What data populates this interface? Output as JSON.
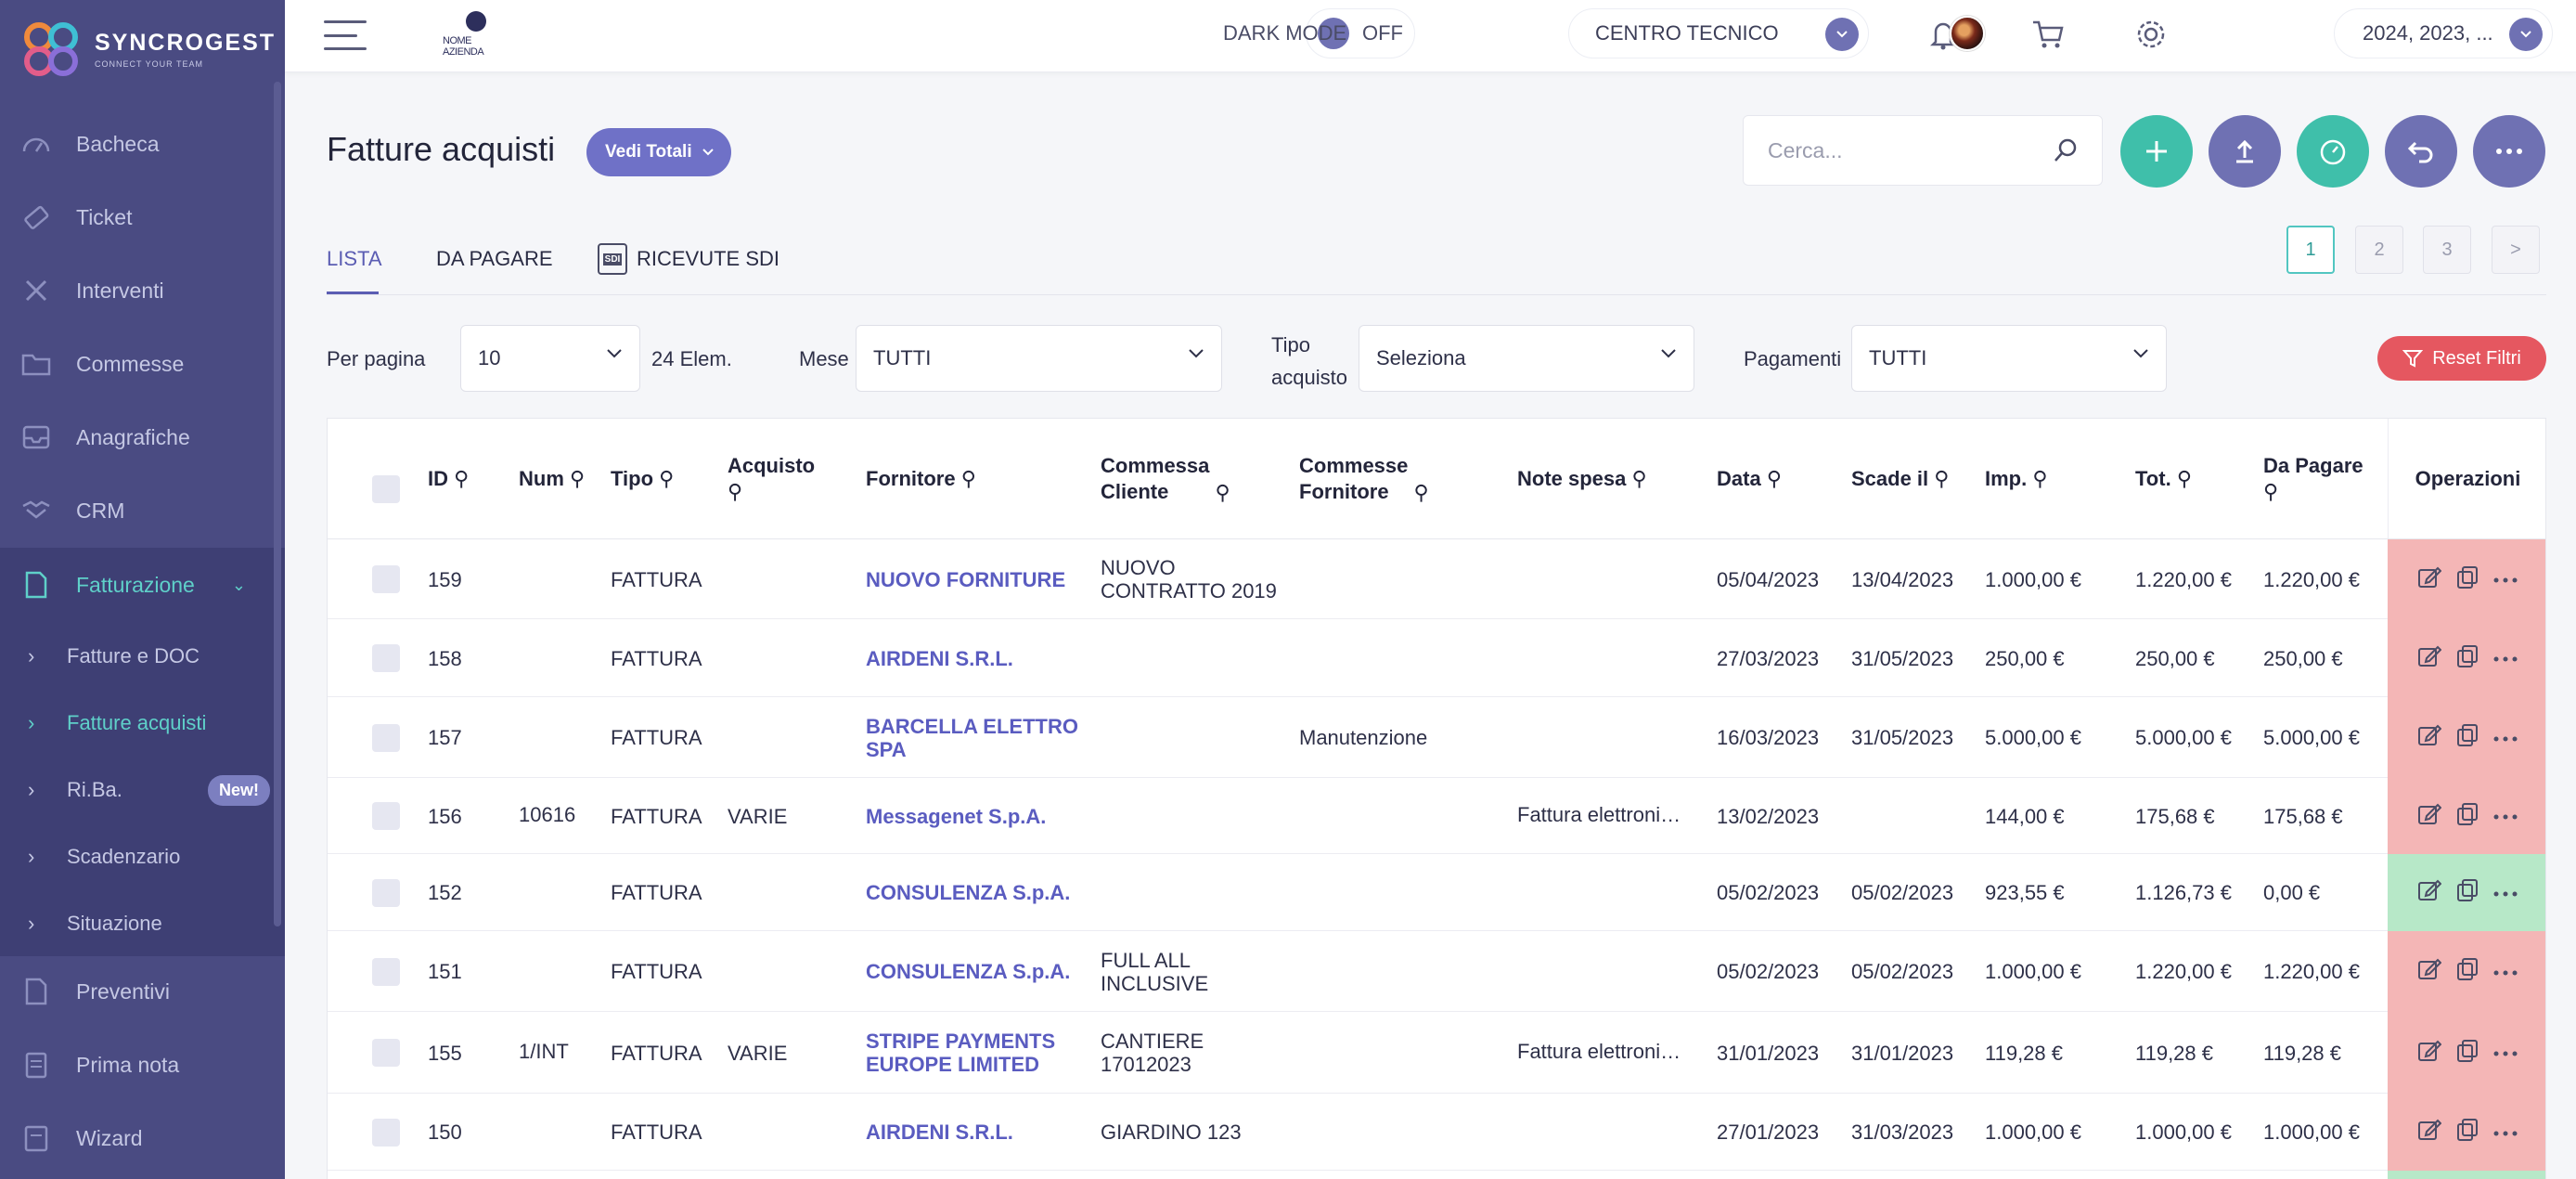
{
  "brand": {
    "name": "SYNCROGEST",
    "tagline": "CONNECT YOUR TEAM"
  },
  "sidebar": {
    "items": [
      {
        "label": "Bacheca",
        "icon": "speedometer-icon"
      },
      {
        "label": "Ticket",
        "icon": "ticket-icon"
      },
      {
        "label": "Interventi",
        "icon": "tools-icon"
      },
      {
        "label": "Commesse",
        "icon": "folder-icon"
      },
      {
        "label": "Anagrafiche",
        "icon": "inbox-icon"
      },
      {
        "label": "CRM",
        "icon": "handshake-icon"
      },
      {
        "label": "Fatturazione",
        "icon": "document-icon"
      }
    ],
    "sub_items": [
      {
        "label": "Fatture e DOC"
      },
      {
        "label": "Fatture acquisti"
      },
      {
        "label": "Ri.Ba.",
        "badge": "New!"
      },
      {
        "label": "Scadenzario"
      },
      {
        "label": "Situazione"
      }
    ],
    "bottom_items": [
      {
        "label": "Preventivi",
        "icon": "quote-doc-icon"
      },
      {
        "label": "Prima nota",
        "icon": "notepad-icon"
      },
      {
        "label": "Wizard",
        "icon": "wizard-icon"
      }
    ]
  },
  "topbar": {
    "company_logo_text": "NOME AZIENDA",
    "dark_mode_label": "DARK MODE",
    "dark_mode_state": "OFF",
    "centro_label": "CENTRO TECNICO",
    "years_label": "2024, 2023, ..."
  },
  "page": {
    "title": "Fatture acquisti",
    "totali_button": "Vedi Totali",
    "search_placeholder": "Cerca...",
    "tabs": [
      "LISTA",
      "DA PAGARE",
      "RICEVUTE SDI"
    ],
    "sdi_icon_text": "SDI",
    "pager": [
      "1",
      "2",
      "3",
      ">"
    ]
  },
  "filters": {
    "per_pagina_label": "Per pagina",
    "per_pagina_value": "10",
    "count_label": "24 Elem.",
    "mese_label": "Mese",
    "mese_value": "TUTTI",
    "tipo_label": "Tipo\nacquisto",
    "tipo_value": "Seleziona",
    "pagamenti_label": "Pagamenti",
    "pagamenti_value": "TUTTI",
    "reset_label": "Reset Filtri"
  },
  "colors": {
    "sidebar": "#4a4b82",
    "accent": "#6f71c7",
    "teal": "#3fbfaa",
    "reset": "#e55760",
    "row_unpaid": "#f4b6b6",
    "row_paid": "#b7e8c8"
  },
  "table": {
    "headers": {
      "id": "ID",
      "num": "Num",
      "tipo": "Tipo",
      "acquisto": "Acquisto",
      "fornitore": "Fornitore",
      "commessa_cliente": "Commessa\nCliente",
      "commesse_fornitore": "Commesse\nFornitore",
      "note_spesa": "Note spesa",
      "data": "Data",
      "scade_il": "Scade il",
      "imp": "Imp.",
      "tot": "Tot.",
      "da_pagare": "Da Pagare",
      "operazioni": "Operazioni"
    },
    "rows": [
      {
        "id": "159",
        "num": "",
        "tipo": "FATTURA",
        "acquisto": "",
        "fornitore": "NUOVO FORNITURE",
        "commessa_cliente": "NUOVO\nCONTRATTO 2019",
        "commesse_fornitore": "",
        "note_spesa": "",
        "data": "05/04/2023",
        "scade_il": "13/04/2023",
        "imp": "1.000,00 €",
        "tot": "1.220,00 €",
        "da_pagare": "1.220,00 €",
        "status": "unpaid"
      },
      {
        "id": "158",
        "num": "",
        "tipo": "FATTURA",
        "acquisto": "",
        "fornitore": "AIRDENI S.R.L.",
        "commessa_cliente": "",
        "commesse_fornitore": "",
        "note_spesa": "",
        "data": "27/03/2023",
        "scade_il": "31/05/2023",
        "imp": "250,00 €",
        "tot": "250,00 €",
        "da_pagare": "250,00 €",
        "status": "unpaid"
      },
      {
        "id": "157",
        "num": "",
        "tipo": "FATTURA",
        "acquisto": "",
        "fornitore": "BARCELLA ELETTRO\nSPA",
        "commessa_cliente": "",
        "commesse_fornitore": "Manutenzione",
        "note_spesa": "",
        "data": "16/03/2023",
        "scade_il": "31/05/2023",
        "imp": "5.000,00 €",
        "tot": "5.000,00 €",
        "da_pagare": "5.000,00 €",
        "status": "unpaid"
      },
      {
        "id": "156",
        "num": "10616",
        "tipo": "FATTURA",
        "acquisto": "VARIE",
        "fornitore": "Messagenet S.p.A.",
        "commessa_cliente": "",
        "commesse_fornitore": "",
        "note_spesa": "Fattura elettroni…",
        "data": "13/02/2023",
        "scade_il": "",
        "imp": "144,00 €",
        "tot": "175,68 €",
        "da_pagare": "175,68 €",
        "status": "unpaid"
      },
      {
        "id": "152",
        "num": "",
        "tipo": "FATTURA",
        "acquisto": "",
        "fornitore": "CONSULENZA S.p.A.",
        "commessa_cliente": "",
        "commesse_fornitore": "",
        "note_spesa": "",
        "data": "05/02/2023",
        "scade_il": "05/02/2023",
        "imp": "923,55 €",
        "tot": "1.126,73 €",
        "da_pagare": "0,00 €",
        "status": "paid"
      },
      {
        "id": "151",
        "num": "",
        "tipo": "FATTURA",
        "acquisto": "",
        "fornitore": "CONSULENZA S.p.A.",
        "commessa_cliente": "FULL ALL\nINCLUSIVE",
        "commesse_fornitore": "",
        "note_spesa": "",
        "data": "05/02/2023",
        "scade_il": "05/02/2023",
        "imp": "1.000,00 €",
        "tot": "1.220,00 €",
        "da_pagare": "1.220,00 €",
        "status": "unpaid"
      },
      {
        "id": "155",
        "num": "1/INT",
        "tipo": "FATTURA",
        "acquisto": "VARIE",
        "fornitore": "STRIPE PAYMENTS\nEUROPE LIMITED",
        "commessa_cliente": "CANTIERE\n17012023",
        "commesse_fornitore": "",
        "note_spesa": "Fattura elettroni…",
        "data": "31/01/2023",
        "scade_il": "31/01/2023",
        "imp": "119,28 €",
        "tot": "119,28 €",
        "da_pagare": "119,28 €",
        "status": "unpaid"
      },
      {
        "id": "150",
        "num": "",
        "tipo": "FATTURA",
        "acquisto": "",
        "fornitore": "AIRDENI S.R.L.",
        "commessa_cliente": "GIARDINO 123",
        "commesse_fornitore": "",
        "note_spesa": "",
        "data": "27/01/2023",
        "scade_il": "31/03/2023",
        "imp": "1.000,00 €",
        "tot": "1.000,00 €",
        "da_pagare": "1.000,00 €",
        "status": "unpaid"
      }
    ]
  }
}
